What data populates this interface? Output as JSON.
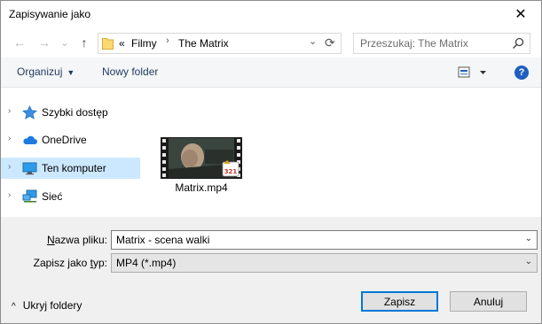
{
  "window": {
    "title": "Zapisywanie jako",
    "close_glyph": "✕"
  },
  "nav": {
    "back_glyph": "←",
    "forward_glyph": "→",
    "recent_glyph": "⌄",
    "up_glyph": "↑",
    "address": {
      "overflow": "«",
      "crumbs": [
        "Filmy",
        "The Matrix"
      ],
      "separator": "›",
      "dropdown_glyph": "⌄",
      "refresh_glyph": "⟳"
    },
    "search_placeholder": "Przeszukaj: The Matrix"
  },
  "toolbar": {
    "organize_label": "Organizuj",
    "new_folder_label": "Nowy folder",
    "help_glyph": "?"
  },
  "sidebar": {
    "items": [
      {
        "label": "Szybki dostęp",
        "icon": "star-icon",
        "selected": false
      },
      {
        "label": "OneDrive",
        "icon": "cloud-icon",
        "selected": false
      },
      {
        "label": "Ten komputer",
        "icon": "computer-icon",
        "selected": true
      },
      {
        "label": "Sieć",
        "icon": "network-icon",
        "selected": false
      }
    ],
    "chevron_glyph": "›"
  },
  "files": [
    {
      "name": "Matrix.mp4",
      "icon": "video-file-icon",
      "badge": "321"
    }
  ],
  "form": {
    "filename_label_pre": "",
    "filename_label_underline": "N",
    "filename_label_post": "azwa pliku:",
    "filename_value": "Matrix - scena walki",
    "type_label_pre": "Zapisz jako ",
    "type_label_underline": "t",
    "type_label_post": "yp:",
    "type_value": "MP4 (*.mp4)",
    "arrow_glyph": "⌄"
  },
  "footer": {
    "hide_folders_label": "Ukryj foldery",
    "hide_chevron": "^",
    "save_label": "Zapisz",
    "cancel_label": "Anuluj"
  },
  "colors": {
    "accent": "#0078d7",
    "selection": "#cce8ff",
    "link": "#1e3a5f"
  }
}
